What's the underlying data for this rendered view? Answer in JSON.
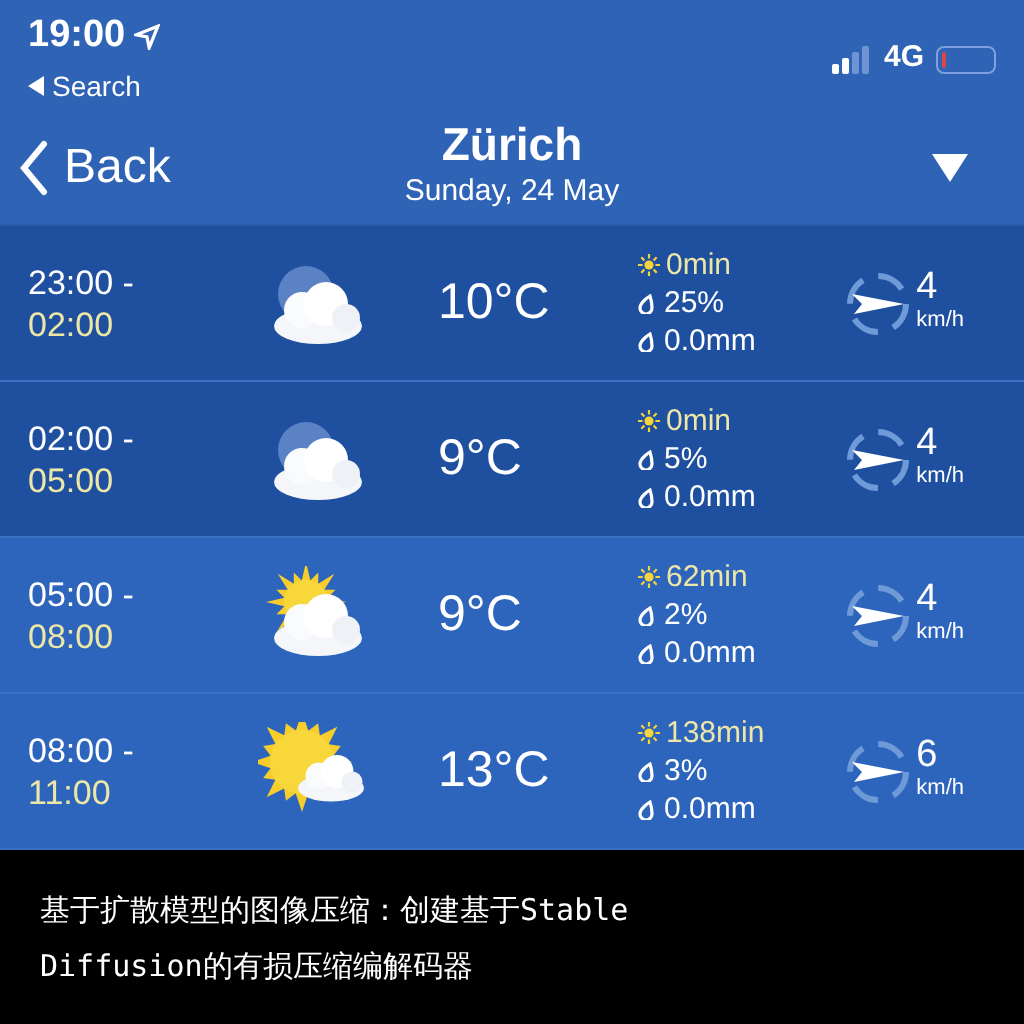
{
  "status_bar": {
    "time": "19:00",
    "back_app": "Search",
    "network": "4G"
  },
  "nav": {
    "back": "Back",
    "title": "Zürich",
    "subtitle": "Sunday, 24 May"
  },
  "rows": [
    {
      "from": "23:00 -",
      "to": "02:00",
      "night": true,
      "kind": "moon-cloud",
      "temp": "10°C",
      "sun": "0min",
      "chance": "25%",
      "rain": "0.0mm",
      "wind": "4",
      "wind_unit": "km/h"
    },
    {
      "from": "02:00 -",
      "to": "05:00",
      "night": true,
      "kind": "moon-cloud",
      "temp": "9°C",
      "sun": "0min",
      "chance": "5%",
      "rain": "0.0mm",
      "wind": "4",
      "wind_unit": "km/h"
    },
    {
      "from": "05:00 -",
      "to": "08:00",
      "night": false,
      "kind": "sun-cloud",
      "temp": "9°C",
      "sun": "62min",
      "chance": "2%",
      "rain": "0.0mm",
      "wind": "4",
      "wind_unit": "km/h"
    },
    {
      "from": "08:00 -",
      "to": "11:00",
      "night": false,
      "kind": "sun-big-cloud",
      "temp": "13°C",
      "sun": "138min",
      "chance": "3%",
      "rain": "0.0mm",
      "wind": "6",
      "wind_unit": "km/h"
    }
  ],
  "caption": "基于扩散模型的图像压缩：创建基于Stable\nDiffusion的有损压缩编解码器"
}
